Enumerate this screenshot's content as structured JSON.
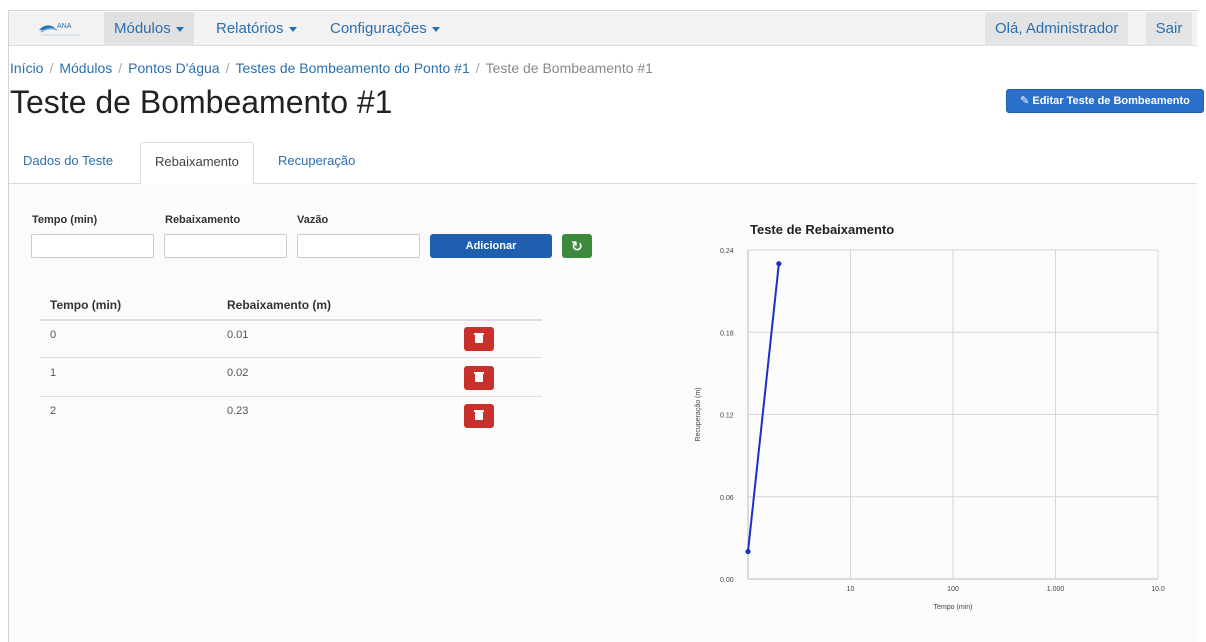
{
  "navbar": {
    "brand": "ANA",
    "menu": [
      {
        "label": "Módulos"
      },
      {
        "label": "Relatórios"
      },
      {
        "label": "Configurações"
      }
    ],
    "greeting": "Olá, Administrador",
    "logout": "Sair"
  },
  "breadcrumb": {
    "items": [
      "Início",
      "Módulos",
      "Pontos D'água",
      "Testes de Bombeamento do Ponto #1"
    ],
    "current": "Teste de Bombeamento #1"
  },
  "page": {
    "title": "Teste de Bombeamento #1",
    "edit_button": "Editar Teste de Bombeamento"
  },
  "tabs": [
    {
      "label": "Dados do Teste",
      "active": false
    },
    {
      "label": "Rebaixamento",
      "active": true
    },
    {
      "label": "Recuperação",
      "active": false
    }
  ],
  "form": {
    "tempo_label": "Tempo (min)",
    "rebaixamento_label": "Rebaixamento",
    "vazao_label": "Vazão",
    "tempo_value": "",
    "rebaixamento_value": "",
    "vazao_value": "",
    "add_button": "Adicionar",
    "refresh_icon": "refresh-icon"
  },
  "table": {
    "headers": [
      "Tempo (min)",
      "Rebaixamento (m)"
    ],
    "rows": [
      {
        "tempo": "0",
        "rebaixamento": "0.01"
      },
      {
        "tempo": "1",
        "rebaixamento": "0.02"
      },
      {
        "tempo": "2",
        "rebaixamento": "0.23"
      }
    ],
    "delete_icon": "trash-icon"
  },
  "chart_data": {
    "type": "line",
    "title": "Teste de Rebaixamento",
    "xlabel": "Tempo (min)",
    "ylabel": "Recuperação (m)",
    "x_scale": "log",
    "y_ticks": [
      "0.24",
      "0.18",
      "0.12",
      "0.06",
      "0.00"
    ],
    "x_ticks": [
      "10",
      "100",
      "1.000",
      "10.0"
    ],
    "ylim": [
      0,
      0.24
    ],
    "grid": true,
    "series": [
      {
        "color": "#1c2fc8",
        "x": [
          1,
          2
        ],
        "y": [
          0.02,
          0.23
        ]
      }
    ]
  },
  "colors": {
    "primary": "#2a6fc9",
    "success": "#3d8a3d",
    "danger": "#c9302c",
    "line": "#1c2fc8"
  }
}
